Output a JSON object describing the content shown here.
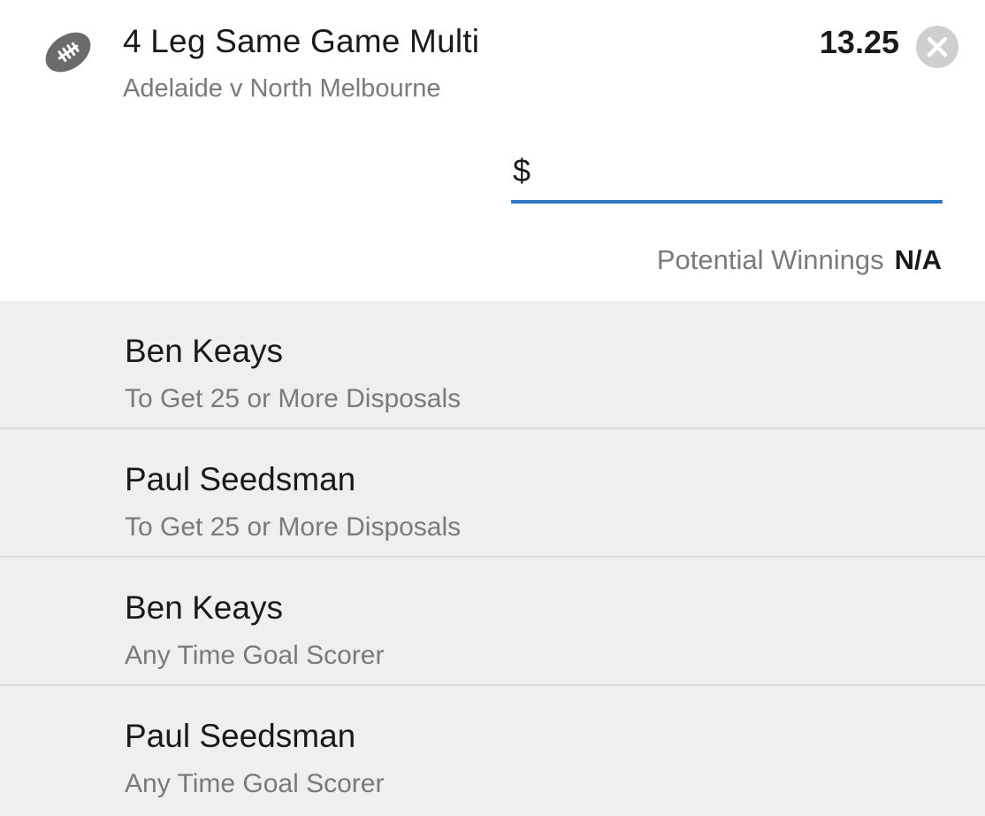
{
  "bet": {
    "title": "4 Leg Same Game Multi",
    "match": "Adelaide v North Melbourne",
    "odds": "13.25",
    "sport_icon": "football-icon",
    "remove_icon": "close-circle-icon"
  },
  "stake": {
    "currency_symbol": "$",
    "value": "",
    "accent_color": "#2f78c4"
  },
  "winnings": {
    "label": "Potential Winnings",
    "value": "N/A"
  },
  "legs": [
    {
      "player": "Ben Keays",
      "market": "To Get 25 or More Disposals"
    },
    {
      "player": "Paul Seedsman",
      "market": "To Get 25 or More Disposals"
    },
    {
      "player": "Ben Keays",
      "market": "Any Time Goal Scorer"
    },
    {
      "player": "Paul Seedsman",
      "market": "Any Time Goal Scorer"
    }
  ]
}
